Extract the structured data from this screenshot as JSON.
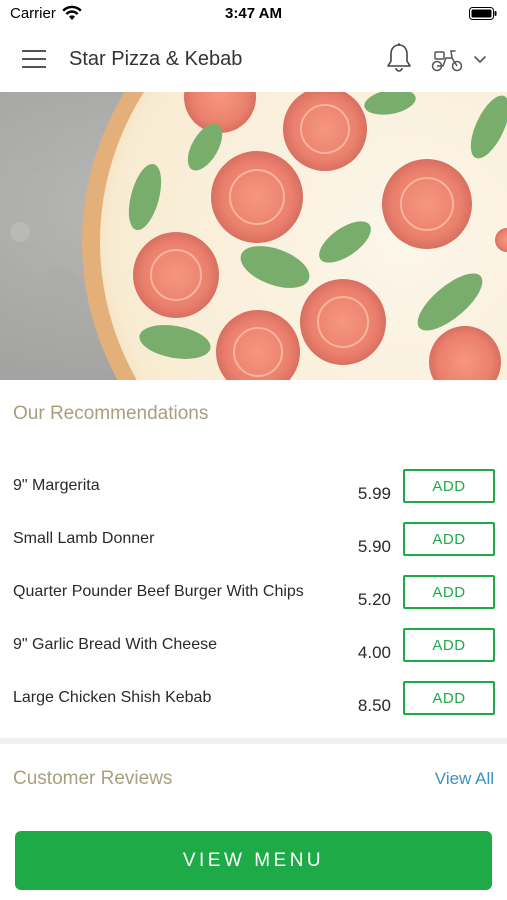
{
  "status_bar": {
    "carrier": "Carrier",
    "time": "3:47 AM",
    "icons": [
      "wifi-icon",
      "battery-icon"
    ]
  },
  "header": {
    "menu_icon": "menu-icon",
    "title": "Star Pizza & Kebab",
    "notification_icon": "bell-icon",
    "delivery_icon": "scooter-icon",
    "dropdown_icon": "chevron-down-icon"
  },
  "hero": {
    "image": "pizza-photo"
  },
  "recommendations": {
    "title": "Our Recommendations",
    "items": [
      {
        "name": "9\" Margerita",
        "price": "5.99",
        "button": "ADD"
      },
      {
        "name": "Small Lamb Donner",
        "price": "5.90",
        "button": "ADD"
      },
      {
        "name": "Quarter Pounder Beef Burger With Chips",
        "price": "5.20",
        "button": "ADD"
      },
      {
        "name": "9\" Garlic Bread With Cheese",
        "price": "4.00",
        "button": "ADD"
      },
      {
        "name": "Large Chicken Shish Kebab",
        "price": "8.50",
        "button": "ADD"
      }
    ]
  },
  "reviews": {
    "title": "Customer Reviews",
    "view_all": "View All"
  },
  "footer": {
    "view_menu": "VIEW MENU"
  },
  "colors": {
    "accent_green": "#1faa48",
    "section_title": "#a89f7e",
    "link_blue": "#3c8fc8"
  }
}
